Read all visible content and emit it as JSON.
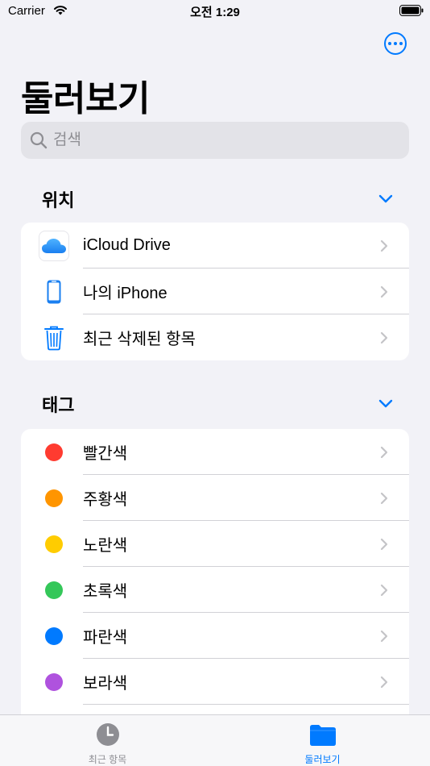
{
  "status_bar": {
    "carrier": "Carrier",
    "time": "오전 1:29"
  },
  "header": {
    "title": "둘러보기",
    "more_icon": "ellipsis-circle-icon"
  },
  "search": {
    "placeholder": "검색"
  },
  "locations": {
    "title": "위치",
    "items": [
      {
        "label": "iCloud Drive",
        "icon": "icloud-icon"
      },
      {
        "label": "나의 iPhone",
        "icon": "iphone-icon"
      },
      {
        "label": "최근 삭제된 항목",
        "icon": "trash-icon"
      }
    ]
  },
  "tags": {
    "title": "태그",
    "items": [
      {
        "label": "빨간색",
        "color": "#ff3b30"
      },
      {
        "label": "주황색",
        "color": "#ff9500"
      },
      {
        "label": "노란색",
        "color": "#ffcc00"
      },
      {
        "label": "초록색",
        "color": "#34c759"
      },
      {
        "label": "파란색",
        "color": "#007aff"
      },
      {
        "label": "보라색",
        "color": "#af52de"
      }
    ]
  },
  "tab_bar": {
    "tabs": [
      {
        "label": "최근 항목",
        "icon": "clock-icon",
        "active": false
      },
      {
        "label": "둘러보기",
        "icon": "folder-icon",
        "active": true
      }
    ]
  },
  "colors": {
    "accent": "#007aff",
    "background": "#f2f2f7"
  }
}
